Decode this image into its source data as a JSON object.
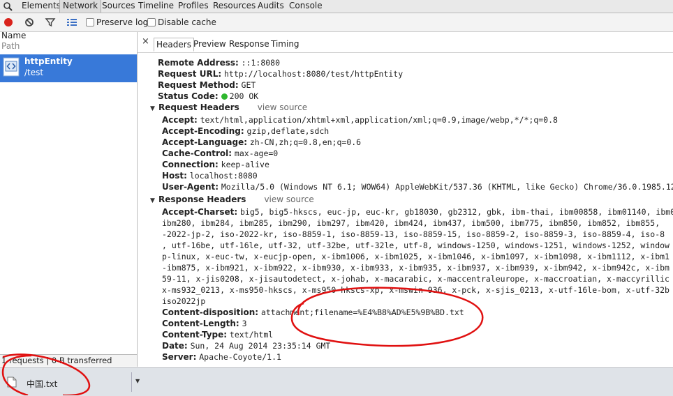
{
  "top_tabs": [
    "Elements",
    "Network",
    "Sources",
    "Timeline",
    "Profiles",
    "Resources",
    "Audits",
    "Console"
  ],
  "toolbar": {
    "preserve_log": "Preserve log",
    "disable_cache": "Disable cache"
  },
  "list": {
    "col_name": "Name",
    "col_path": "Path",
    "items": [
      {
        "name": "httpEntity",
        "path": "/test"
      }
    ]
  },
  "status": "1 requests | 0 B transferred",
  "detail": {
    "close": "×",
    "tabs": [
      "Headers",
      "Preview",
      "Response",
      "Timing"
    ],
    "general": [
      {
        "label": "Remote Address:",
        "value": "::1:8080"
      },
      {
        "label": "Request URL:",
        "value": "http://localhost:8080/test/httpEntity"
      },
      {
        "label": "Request Method:",
        "value": "GET"
      }
    ],
    "status_code": {
      "label": "Status Code:",
      "value": "200 OK"
    },
    "request_headers": {
      "title": "Request Headers",
      "view_source": "view source",
      "items": [
        {
          "label": "Accept:",
          "value": "text/html,application/xhtml+xml,application/xml;q=0.9,image/webp,*/*;q=0.8"
        },
        {
          "label": "Accept-Encoding:",
          "value": "gzip,deflate,sdch"
        },
        {
          "label": "Accept-Language:",
          "value": "zh-CN,zh;q=0.8,en;q=0.6"
        },
        {
          "label": "Cache-Control:",
          "value": "max-age=0"
        },
        {
          "label": "Connection:",
          "value": "keep-alive"
        },
        {
          "label": "Host:",
          "value": "localhost:8080"
        },
        {
          "label": "User-Agent:",
          "value": "Mozilla/5.0 (Windows NT 6.1; WOW64) AppleWebKit/537.36 (KHTML, like Gecko) Chrome/36.0.1985.12"
        }
      ]
    },
    "response_headers": {
      "title": "Response Headers",
      "view_source": "view source",
      "accept_charset_label": "Accept-Charset:",
      "accept_charset_lines": [
        "big5, big5-hkscs, euc-jp, euc-kr, gb18030, gb2312, gbk, ibm-thai, ibm00858, ibm01140, ibm01",
        "ibm280, ibm284, ibm285, ibm290, ibm297, ibm420, ibm424, ibm437, ibm500, ibm775, ibm850, ibm852, ibm855,",
        "-2022-jp-2, iso-2022-kr, iso-8859-1, iso-8859-13, iso-8859-15, iso-8859-2, iso-8859-3, iso-8859-4, iso-8",
        ", utf-16be, utf-16le, utf-32, utf-32be, utf-32le, utf-8, windows-1250, windows-1251, windows-1252, window",
        "p-linux, x-euc-tw, x-eucjp-open, x-ibm1006, x-ibm1025, x-ibm1046, x-ibm1097, x-ibm1098, x-ibm1112, x-ibm1",
        "-ibm875, x-ibm921, x-ibm922, x-ibm930, x-ibm933, x-ibm935, x-ibm937, x-ibm939, x-ibm942, x-ibm942c, x-ibm",
        "59-11, x-jis0208, x-jisautodetect, x-johab, x-macarabic, x-maccentraleurope, x-maccroatian, x-maccyrillic",
        "x-ms932_0213, x-ms950-hkscs, x-ms950-hkscs-xp, x-mswin-936, x-pck, x-sjis_0213, x-utf-16le-bom, x-utf-32b",
        "iso2022jp"
      ],
      "items": [
        {
          "label": "Content-disposition:",
          "value": "attachment;filename=%E4%B8%AD%E5%9B%BD.txt"
        },
        {
          "label": "Content-Length:",
          "value": "3"
        },
        {
          "label": "Content-Type:",
          "value": "text/html"
        },
        {
          "label": "Date:",
          "value": "Sun, 24 Aug 2014 23:35:14 GMT"
        },
        {
          "label": "Server:",
          "value": "Apache-Coyote/1.1"
        }
      ]
    }
  },
  "download": {
    "filename": "中国.txt"
  },
  "annotation_color": "#e01010"
}
